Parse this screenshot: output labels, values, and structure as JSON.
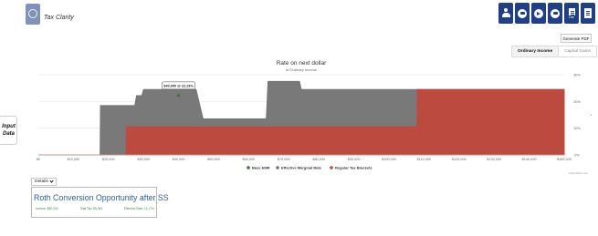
{
  "header": {
    "app_title": "Tax Clarity",
    "logo_icon": "tax-clarity-logo",
    "toolbar_icons": [
      "user-icon",
      "car-icon",
      "play-icon",
      "calculator-icon",
      "lite-document-icon",
      "document-icon"
    ],
    "lite_label": "Lite"
  },
  "actions": {
    "generate_pdf": "Generate PDF"
  },
  "tabs": [
    {
      "label": "Ordinary Income",
      "active": true
    },
    {
      "label": "Capital Gains",
      "active": false
    }
  ],
  "side_panel": {
    "line1": "Input",
    "line2": "Data"
  },
  "details": {
    "label": "Details"
  },
  "roth_card": {
    "title": "Roth Conversion Opportunity after SS",
    "stats": [
      "Income: $80,000",
      "Total Tax: $9,063",
      "Effective Rate: 11.17%"
    ]
  },
  "chart_data": {
    "type": "area",
    "title": "Rate on next dollar",
    "subtitle": "of Ordinary Income",
    "ylabel": "Effective Marginal Tax Rate",
    "credit": "Highcharts.com",
    "xlim": [
      0,
      150000
    ],
    "ylim": [
      0,
      30
    ],
    "x_ticks": [
      "$0",
      "$10,000",
      "$20,000",
      "$30,000",
      "$40,000",
      "$50,000",
      "$60,000",
      "$70,000",
      "$80,000",
      "$90,000",
      "$100,000",
      "$110,000",
      "$120,000",
      "$130,000",
      "$140,000",
      "$150,000"
    ],
    "x_tick_values": [
      0,
      10000,
      20000,
      30000,
      40000,
      50000,
      60000,
      70000,
      80000,
      90000,
      100000,
      110000,
      120000,
      130000,
      140000,
      150000
    ],
    "y_ticks": [
      "0%",
      "10%",
      "20%",
      "30%"
    ],
    "y_tick_values": [
      0,
      10,
      20,
      30
    ],
    "colors": {
      "emr": "#727272",
      "brackets": "#c1483c",
      "base": "#2e7d32",
      "grid": "#e6e6e6"
    },
    "series": [
      {
        "name": "Effective Marginal Rate",
        "points": [
          [
            0,
            0
          ],
          [
            17600,
            0
          ],
          [
            17700,
            18.5
          ],
          [
            27500,
            18.5
          ],
          [
            28000,
            22.2
          ],
          [
            29500,
            22.2
          ],
          [
            30000,
            24.5
          ],
          [
            45000,
            24.5
          ],
          [
            47000,
            13.5
          ],
          [
            65000,
            13.5
          ],
          [
            65500,
            27.5
          ],
          [
            74500,
            27.5
          ],
          [
            75000,
            24.5
          ],
          [
            150000,
            24.5
          ]
        ]
      },
      {
        "name": "Regular Tax Brackets",
        "points": [
          [
            0,
            0
          ],
          [
            25000,
            0
          ],
          [
            25100,
            10.5
          ],
          [
            108000,
            10.5
          ],
          [
            108100,
            24.5
          ],
          [
            150000,
            24.5
          ]
        ]
      }
    ],
    "base_emr": {
      "x": 40000,
      "y": 22.2
    },
    "tooltip": "$40,000 @ 22.23%",
    "legend": [
      "Base EMR",
      "Effective Marginal Rate",
      "Regular Tax Brackets"
    ],
    "legend_position": "bottom-center"
  }
}
